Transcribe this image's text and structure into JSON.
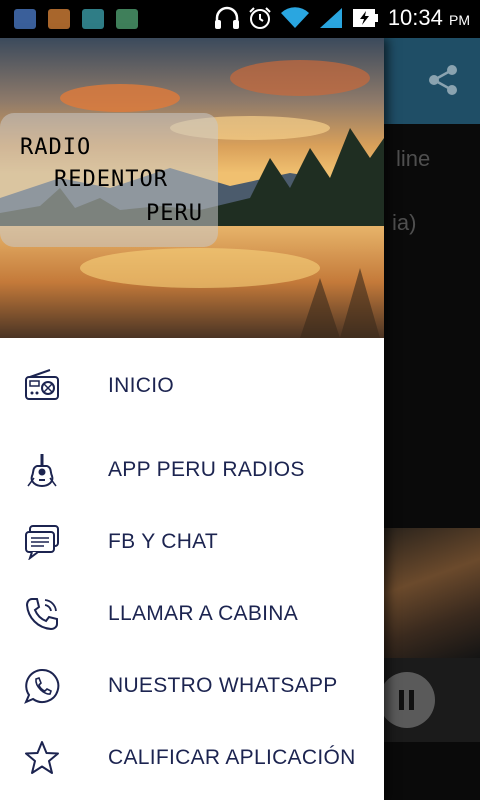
{
  "status_bar": {
    "time": "10:34",
    "ampm": "PM"
  },
  "drawer": {
    "logo": {
      "line1": "RADIO",
      "line2": "REDENTOR",
      "line3": "PERU"
    },
    "menu": [
      {
        "label": "INICIO",
        "icon": "radio-icon"
      },
      {
        "label": "APP PERU RADIOS",
        "icon": "guitar-icon"
      },
      {
        "label": "FB Y CHAT",
        "icon": "chat-icon"
      },
      {
        "label": "LLAMAR A CABINA",
        "icon": "phone-icon"
      },
      {
        "label": "NUESTRO WHATSAPP",
        "icon": "whatsapp-icon"
      },
      {
        "label": "CALIFICAR APLICACIÓN",
        "icon": "star-icon"
      }
    ]
  },
  "background_app": {
    "text1": "line",
    "text2": "ia)"
  },
  "colors": {
    "toolbar": "#1f4e66",
    "menu_text": "#1c2450"
  }
}
